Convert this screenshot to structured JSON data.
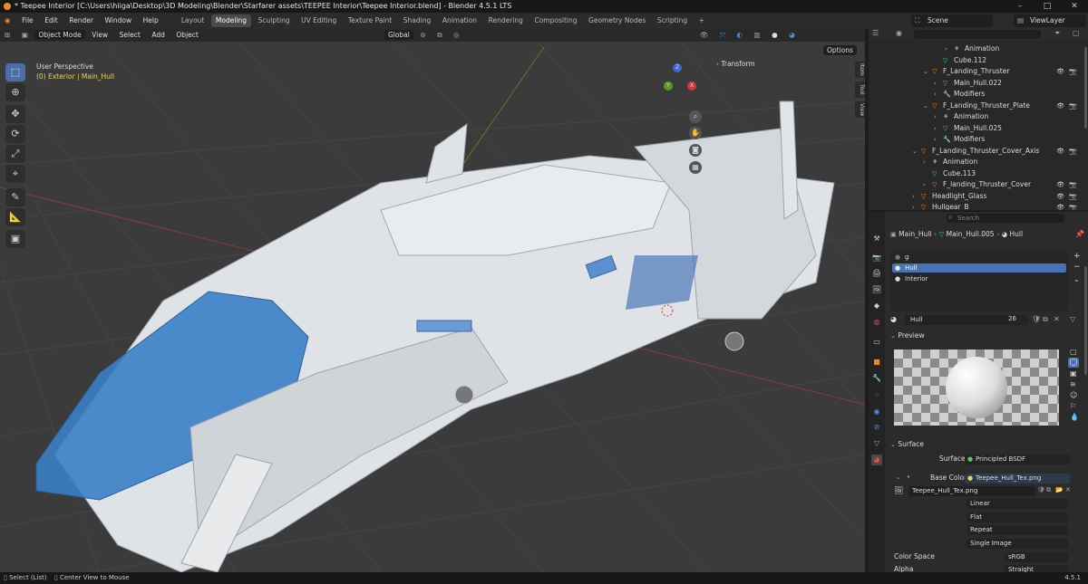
{
  "title": "* Teepee Interior [C:\\Users\\hiiga\\Desktop\\3D Modeling\\Blender\\Starfarer assets\\TEEPEE Interior\\Teepee Interior.blend] - Blender 4.5.1 LTS",
  "window_controls": [
    "–",
    "□",
    "✕"
  ],
  "menu": [
    "File",
    "Edit",
    "Render",
    "Window",
    "Help"
  ],
  "workspaces": [
    "Layout",
    "Modeling",
    "Sculpting",
    "UV Editing",
    "Texture Paint",
    "Shading",
    "Animation",
    "Rendering",
    "Compositing",
    "Geometry Nodes",
    "Scripting"
  ],
  "active_workspace": "Modeling",
  "add_workspace": "+",
  "scene": "Scene",
  "view_layer": "ViewLayer",
  "viewport": {
    "mode": "Object Mode",
    "menus": [
      "View",
      "Select",
      "Add",
      "Object"
    ],
    "transform_orientation": "Global",
    "options": "Options",
    "perspective": "User Perspective",
    "collection_info": "(0) Exterior | Main_Hull",
    "transform_panel": "Transform",
    "side_tabs": [
      "Item",
      "Tool",
      "View"
    ],
    "gizmo_axes": [
      "X",
      "Y",
      "Z"
    ]
  },
  "tools": [
    "select-box",
    "cursor",
    "move",
    "rotate",
    "scale",
    "transform",
    "annotate",
    "measure",
    "add-cube"
  ],
  "outliner": {
    "search_placeholder": "",
    "rows": [
      {
        "name": "Animation",
        "indent": 3,
        "kind": "anim",
        "tri": "›"
      },
      {
        "name": "Cube.112",
        "indent": 2,
        "kind": "mesh",
        "tri": ""
      },
      {
        "name": "F_Landing_Thruster",
        "indent": 1,
        "kind": "object",
        "tri": "⌄"
      },
      {
        "name": "Main_Hull.022",
        "indent": 2,
        "kind": "mesh",
        "tri": "›"
      },
      {
        "name": "Modifiers",
        "indent": 2,
        "kind": "modifier",
        "tri": "›"
      },
      {
        "name": "F_Landing_Thruster_Plate",
        "indent": 1,
        "kind": "object",
        "tri": "⌄"
      },
      {
        "name": "Animation",
        "indent": 2,
        "kind": "anim",
        "tri": "›"
      },
      {
        "name": "Main_Hull.025",
        "indent": 2,
        "kind": "mesh",
        "tri": "›"
      },
      {
        "name": "Modifiers",
        "indent": 2,
        "kind": "modifier",
        "tri": "›"
      },
      {
        "name": "F_Landing_Thruster_Cover_Axis",
        "indent": 0,
        "kind": "object",
        "tri": "⌄"
      },
      {
        "name": "Animation",
        "indent": 1,
        "kind": "anim",
        "tri": "›"
      },
      {
        "name": "Cube.113",
        "indent": 1,
        "kind": "mesh",
        "tri": ""
      },
      {
        "name": "F_landing_Thruster_Cover",
        "indent": 1,
        "kind": "object",
        "tri": "›"
      },
      {
        "name": "Headlight_Glass",
        "indent": 0,
        "kind": "object",
        "tri": "›"
      },
      {
        "name": "Hullgear_B",
        "indent": 0,
        "kind": "object",
        "tri": "›"
      }
    ]
  },
  "properties": {
    "search_placeholder": "Search",
    "breadcrumb": [
      "Main_Hull",
      "Main_Hull.005",
      "Hull"
    ],
    "material_slots": [
      "g",
      "Hull",
      "Interior"
    ],
    "active_slot": "Hull",
    "material_name": "Hull",
    "user_count": "26",
    "preview_label": "Preview",
    "surface_label": "Surface",
    "surface_value": "Principled BSDF",
    "base_color_label": "Base Color",
    "base_color_value": "Teepee_Hull_Tex.png",
    "image_name": "Teepee_Hull_Tex.png",
    "interpolation": "Linear",
    "projection": "Flat",
    "extension": "Repeat",
    "source": "Single Image",
    "color_space_label": "Color Space",
    "color_space_value": "sRGB",
    "alpha_label": "Alpha",
    "alpha_value": "Straight"
  },
  "statusbar": {
    "left1": "Select (List)",
    "left2": "Center View to Mouse",
    "version": "4.5.1"
  },
  "colors": {
    "accent": "#4772b3",
    "active_tool": "#4a6ea8",
    "glass": "#3a7fc8",
    "hull": "#e6e9ec",
    "mesh_icon": "#4ccfa0",
    "object_icon": "#f08a24"
  }
}
